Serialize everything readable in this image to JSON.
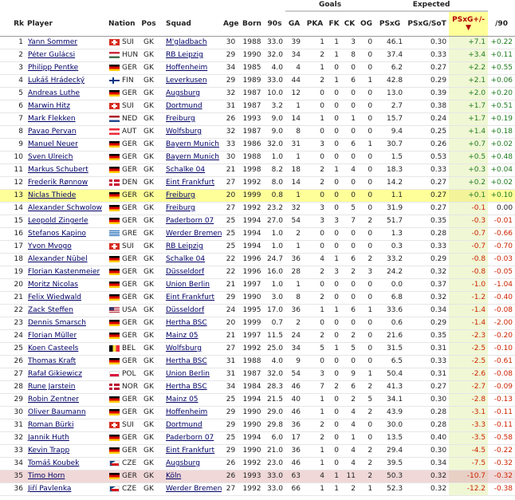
{
  "groups": {
    "goals": "Goals",
    "expected": "Expected"
  },
  "headers": {
    "rk": "Rk",
    "player": "Player",
    "nation": "Nation",
    "pos": "Pos",
    "squad": "Squad",
    "age": "Age",
    "born": "Born",
    "nineties": "90s",
    "ga": "GA",
    "pka": "PKA",
    "fk": "FK",
    "ck": "CK",
    "og": "OG",
    "psxg": "PSxG",
    "psxg_sot": "PSxG/SoT",
    "psxg_pm": "PSxG+/-",
    "sort_arrow": "▼",
    "per90": "/90"
  },
  "flag_colors": {
    "SUI": [
      "#d52b1e",
      "#ffffff"
    ],
    "HUN": [
      "#cd2a3e",
      "#ffffff",
      "#436f4d"
    ],
    "GER": [
      "#000000",
      "#dd0000",
      "#ffce00"
    ],
    "FIN": [
      "#ffffff",
      "#003580"
    ],
    "NED": [
      "#ae1c28",
      "#ffffff",
      "#21468b"
    ],
    "AUT": [
      "#ed2939",
      "#ffffff",
      "#ed2939"
    ],
    "DEN": [
      "#c60c30",
      "#ffffff"
    ],
    "GRE": [
      "#0d5eaf",
      "#ffffff"
    ],
    "USA": [
      "#b22234",
      "#ffffff",
      "#3c3b6e"
    ],
    "BEL": [
      "#000000",
      "#fae042",
      "#ed2939"
    ],
    "POL": [
      "#ffffff",
      "#dc143c"
    ],
    "NOR": [
      "#ba0c2f",
      "#ffffff",
      "#00205b"
    ],
    "CZE": [
      "#ffffff",
      "#d7141a",
      "#11457e"
    ]
  },
  "rows": [
    [
      "1",
      "Yann Sommer",
      "SUI",
      "GK",
      "M'gladbach",
      "30",
      "1988",
      "33.0",
      "39",
      "1",
      "1",
      "3",
      "0",
      "46.1",
      "0.30",
      "+7.1",
      "+0.22"
    ],
    [
      "2",
      "Péter Gulácsi",
      "HUN",
      "GK",
      "RB Leipzig",
      "29",
      "1990",
      "32.0",
      "34",
      "2",
      "1",
      "8",
      "0",
      "37.4",
      "0.33",
      "+3.4",
      "+0.11"
    ],
    [
      "3",
      "Philipp Pentke",
      "GER",
      "GK",
      "Hoffenheim",
      "34",
      "1985",
      "4.0",
      "4",
      "1",
      "0",
      "0",
      "0",
      "6.2",
      "0.27",
      "+2.2",
      "+0.55"
    ],
    [
      "4",
      "Lukáš Hrádecký",
      "FIN",
      "GK",
      "Leverkusen",
      "29",
      "1989",
      "33.0",
      "44",
      "2",
      "1",
      "6",
      "1",
      "42.8",
      "0.29",
      "+2.1",
      "+0.06"
    ],
    [
      "5",
      "Andreas Luthe",
      "GER",
      "GK",
      "Augsburg",
      "32",
      "1987",
      "10.0",
      "12",
      "0",
      "0",
      "0",
      "0",
      "13.0",
      "0.39",
      "+2.0",
      "+0.20"
    ],
    [
      "6",
      "Marwin Hitz",
      "SUI",
      "GK",
      "Dortmund",
      "31",
      "1987",
      "3.2",
      "1",
      "0",
      "0",
      "0",
      "0",
      "2.7",
      "0.38",
      "+1.7",
      "+0.51"
    ],
    [
      "7",
      "Mark Flekken",
      "NED",
      "GK",
      "Freiburg",
      "26",
      "1993",
      "9.0",
      "14",
      "1",
      "0",
      "1",
      "0",
      "15.7",
      "0.24",
      "+1.7",
      "+0.19"
    ],
    [
      "8",
      "Pavao Pervan",
      "AUT",
      "GK",
      "Wolfsburg",
      "32",
      "1987",
      "9.0",
      "8",
      "0",
      "0",
      "0",
      "0",
      "9.4",
      "0.25",
      "+1.4",
      "+0.18"
    ],
    [
      "9",
      "Manuel Neuer",
      "GER",
      "GK",
      "Bayern Munich",
      "33",
      "1986",
      "32.0",
      "31",
      "3",
      "0",
      "6",
      "1",
      "30.7",
      "0.26",
      "+0.7",
      "+0.02"
    ],
    [
      "10",
      "Sven Ulreich",
      "GER",
      "GK",
      "Bayern Munich",
      "30",
      "1988",
      "1.0",
      "1",
      "0",
      "0",
      "0",
      "0",
      "1.5",
      "0.53",
      "+0.5",
      "+0.48"
    ],
    [
      "11",
      "Markus Schubert",
      "GER",
      "GK",
      "Schalke 04",
      "21",
      "1998",
      "8.2",
      "18",
      "2",
      "1",
      "4",
      "0",
      "18.3",
      "0.33",
      "+0.3",
      "+0.04"
    ],
    [
      "12",
      "Frederik Rønnow",
      "DEN",
      "GK",
      "Eint Frankfurt",
      "27",
      "1992",
      "8.0",
      "14",
      "2",
      "0",
      "0",
      "0",
      "14.2",
      "0.27",
      "+0.2",
      "+0.02"
    ],
    [
      "13",
      "Niclas Thiede",
      "GER",
      "GK",
      "Freiburg",
      "20",
      "1999",
      "0.8",
      "1",
      "0",
      "0",
      "0",
      "0",
      "1.1",
      "0.27",
      "+0.1",
      "+0.10"
    ],
    [
      "14",
      "Alexander Schwolow",
      "GER",
      "GK",
      "Freiburg",
      "27",
      "1992",
      "23.2",
      "32",
      "3",
      "0",
      "5",
      "0",
      "31.9",
      "0.27",
      "-0.1",
      "0.00"
    ],
    [
      "15",
      "Leopold Zingerle",
      "GER",
      "GK",
      "Paderborn 07",
      "25",
      "1994",
      "27.0",
      "54",
      "3",
      "3",
      "7",
      "2",
      "51.7",
      "0.35",
      "-0.3",
      "-0.01"
    ],
    [
      "16",
      "Stefanos Kapino",
      "GRE",
      "GK",
      "Werder Bremen",
      "25",
      "1994",
      "1.0",
      "2",
      "0",
      "0",
      "0",
      "0",
      "1.3",
      "0.28",
      "-0.7",
      "-0.66"
    ],
    [
      "17",
      "Yvon Mvogo",
      "SUI",
      "GK",
      "RB Leipzig",
      "25",
      "1994",
      "1.0",
      "1",
      "0",
      "0",
      "0",
      "0",
      "0.3",
      "0.33",
      "-0.7",
      "-0.70"
    ],
    [
      "18",
      "Alexander Nübel",
      "GER",
      "GK",
      "Schalke 04",
      "22",
      "1996",
      "24.7",
      "36",
      "4",
      "1",
      "6",
      "2",
      "33.2",
      "0.29",
      "-0.8",
      "-0.03"
    ],
    [
      "19",
      "Florian Kastenmeier",
      "GER",
      "GK",
      "Düsseldorf",
      "22",
      "1996",
      "16.0",
      "28",
      "2",
      "3",
      "2",
      "3",
      "24.2",
      "0.32",
      "-0.8",
      "-0.05"
    ],
    [
      "20",
      "Moritz Nicolas",
      "GER",
      "GK",
      "Union Berlin",
      "21",
      "1997",
      "1.0",
      "1",
      "0",
      "0",
      "0",
      "0",
      "0.0",
      "0.37",
      "-1.0",
      "-1.04"
    ],
    [
      "21",
      "Felix Wiedwald",
      "GER",
      "GK",
      "Eint Frankfurt",
      "29",
      "1990",
      "3.0",
      "8",
      "2",
      "0",
      "0",
      "0",
      "6.8",
      "0.32",
      "-1.2",
      "-0.40"
    ],
    [
      "22",
      "Zack Steffen",
      "USA",
      "GK",
      "Düsseldorf",
      "24",
      "1995",
      "17.0",
      "36",
      "1",
      "1",
      "6",
      "1",
      "33.6",
      "0.34",
      "-1.4",
      "-0.08"
    ],
    [
      "23",
      "Dennis Smarsch",
      "GER",
      "GK",
      "Hertha BSC",
      "20",
      "1999",
      "0.7",
      "2",
      "0",
      "0",
      "0",
      "0",
      "0.6",
      "0.29",
      "-1.4",
      "-2.00"
    ],
    [
      "24",
      "Florian Müller",
      "GER",
      "GK",
      "Mainz 05",
      "21",
      "1997",
      "11.5",
      "24",
      "2",
      "0",
      "2",
      "0",
      "21.6",
      "0.35",
      "-2.3",
      "-0.20"
    ],
    [
      "25",
      "Koen Casteels",
      "BEL",
      "GK",
      "Wolfsburg",
      "27",
      "1992",
      "25.0",
      "34",
      "5",
      "1",
      "5",
      "0",
      "31.5",
      "0.31",
      "-2.5",
      "-0.10"
    ],
    [
      "26",
      "Thomas Kraft",
      "GER",
      "GK",
      "Hertha BSC",
      "31",
      "1988",
      "4.0",
      "9",
      "0",
      "0",
      "0",
      "0",
      "6.5",
      "0.33",
      "-2.5",
      "-0.61"
    ],
    [
      "27",
      "Rafał Gikiewicz",
      "POL",
      "GK",
      "Union Berlin",
      "31",
      "1987",
      "32.0",
      "54",
      "3",
      "0",
      "9",
      "1",
      "50.4",
      "0.31",
      "-2.6",
      "-0.08"
    ],
    [
      "28",
      "Rune Jarstein",
      "NOR",
      "GK",
      "Hertha BSC",
      "34",
      "1984",
      "28.3",
      "46",
      "7",
      "2",
      "6",
      "2",
      "41.3",
      "0.27",
      "-2.7",
      "-0.09"
    ],
    [
      "29",
      "Robin Zentner",
      "GER",
      "GK",
      "Mainz 05",
      "25",
      "1994",
      "21.5",
      "40",
      "1",
      "0",
      "2",
      "5",
      "34.1",
      "0.30",
      "-2.8",
      "-0.13"
    ],
    [
      "30",
      "Oliver Baumann",
      "GER",
      "GK",
      "Hoffenheim",
      "29",
      "1990",
      "29.0",
      "46",
      "1",
      "0",
      "4",
      "2",
      "43.9",
      "0.28",
      "-3.1",
      "-0.11"
    ],
    [
      "31",
      "Roman Bürki",
      "SUI",
      "GK",
      "Dortmund",
      "29",
      "1990",
      "29.8",
      "36",
      "2",
      "0",
      "4",
      "0",
      "30.0",
      "0.28",
      "-3.3",
      "-0.11"
    ],
    [
      "32",
      "Jannik Huth",
      "GER",
      "GK",
      "Paderborn 07",
      "25",
      "1994",
      "6.0",
      "17",
      "2",
      "0",
      "1",
      "0",
      "13.5",
      "0.40",
      "-3.5",
      "-0.58"
    ],
    [
      "33",
      "Kevin Trapp",
      "GER",
      "GK",
      "Eint Frankfurt",
      "29",
      "1990",
      "21.0",
      "36",
      "1",
      "0",
      "4",
      "2",
      "29.4",
      "0.30",
      "-4.5",
      "-0.22"
    ],
    [
      "34",
      "Tomáš Koubek",
      "CZE",
      "GK",
      "Augsburg",
      "26",
      "1992",
      "23.0",
      "46",
      "1",
      "0",
      "4",
      "2",
      "39.5",
      "0.34",
      "-7.5",
      "-0.32"
    ],
    [
      "35",
      "Timo Horn",
      "GER",
      "GK",
      "Köln",
      "26",
      "1993",
      "33.0",
      "63",
      "4",
      "1",
      "11",
      "2",
      "50.3",
      "0.32",
      "-10.7",
      "-0.32"
    ],
    [
      "36",
      "Jiří Pavlenka",
      "CZE",
      "GK",
      "Werder Bremen",
      "27",
      "1992",
      "33.0",
      "66",
      "1",
      "1",
      "2",
      "1",
      "52.3",
      "0.32",
      "-12.2",
      "-0.38"
    ]
  ],
  "highlight_rows": {
    "yellow": "13",
    "pink": "35"
  }
}
